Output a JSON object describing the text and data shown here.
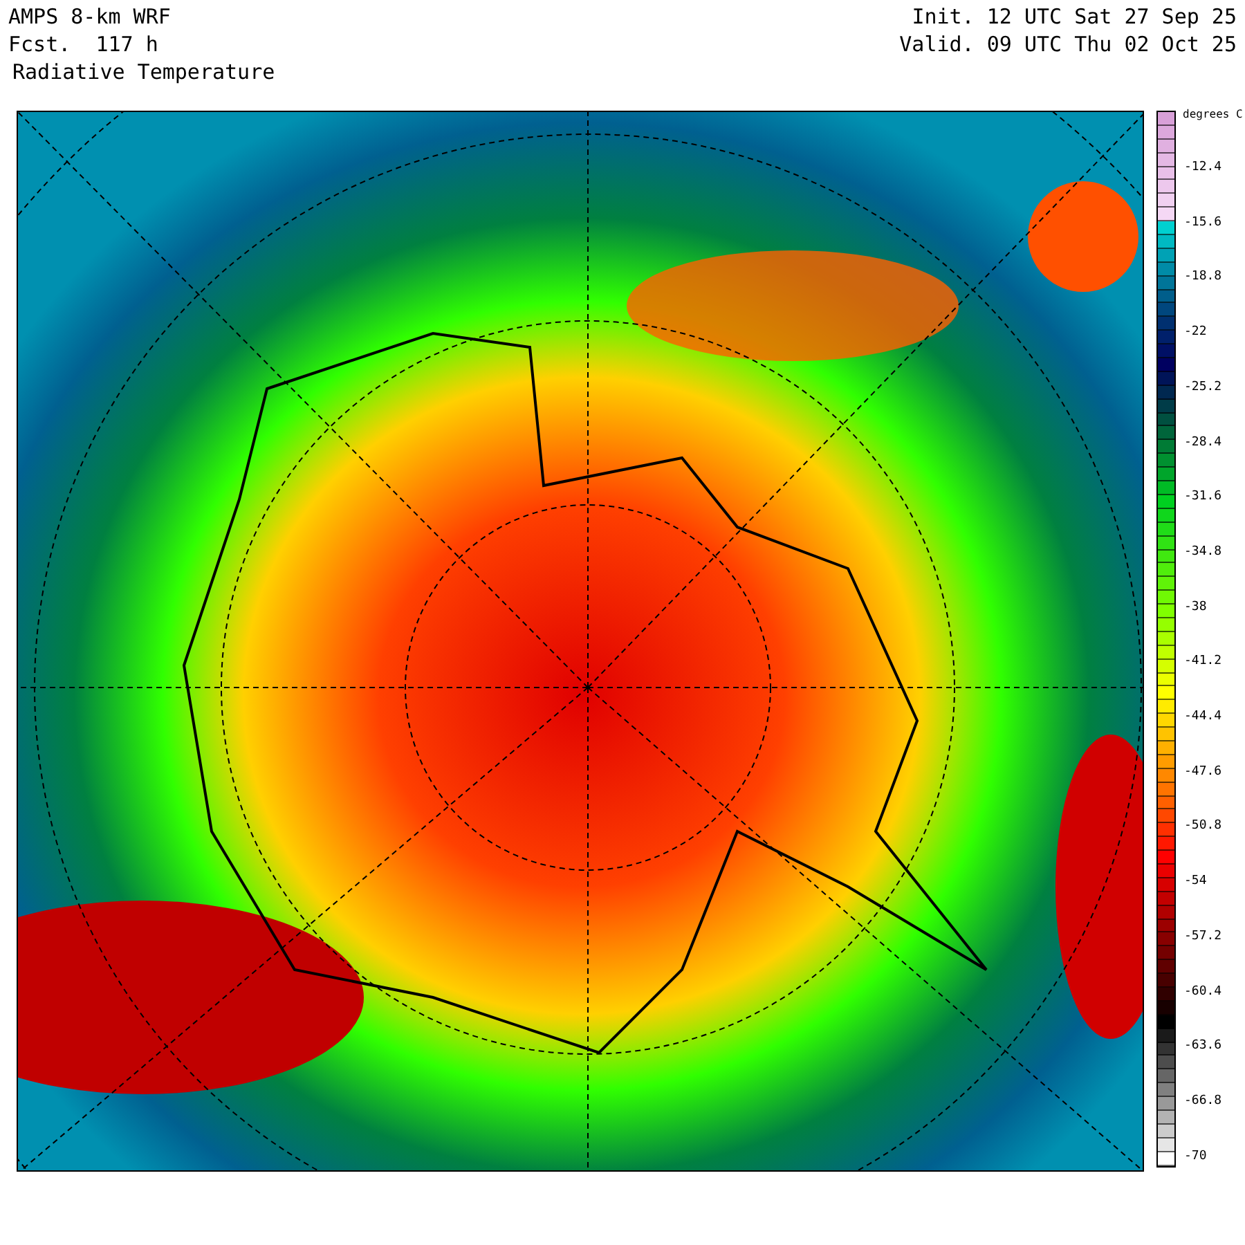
{
  "header": {
    "model": "AMPS 8-km WRF",
    "forecast": "Fcst.  117 h",
    "field": "Radiative Temperature",
    "init": "Init. 12 UTC Sat 27 Sep 25",
    "valid": "Valid. 09 UTC Thu 02 Oct 25"
  },
  "colorbar": {
    "unit": "degrees C",
    "labels": [
      "-12.4",
      "-15.6",
      "-18.8",
      "-22",
      "-25.2",
      "-28.4",
      "-31.6",
      "-34.8",
      "-38",
      "-41.2",
      "-44.4",
      "-47.6",
      "-50.8",
      "-54",
      "-57.2",
      "-60.4",
      "-63.6",
      "-66.8",
      "-70"
    ]
  }
}
